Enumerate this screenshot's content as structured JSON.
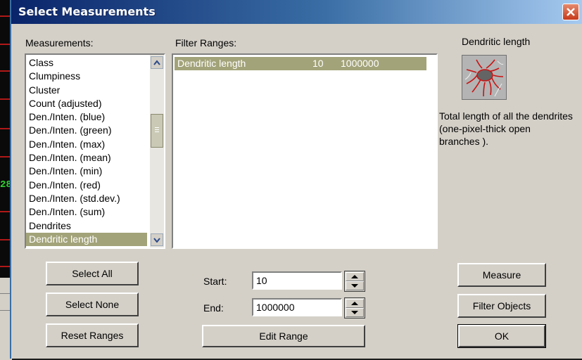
{
  "dialog": {
    "title": "Select Measurements",
    "measurements_label": "Measurements:",
    "filter_ranges_label": "Filter Ranges:"
  },
  "measurements": {
    "items": [
      "Class",
      "Clumpiness",
      "Cluster",
      "Count (adjusted)",
      "Den./Inten. (blue)",
      "Den./Inten. (green)",
      "Den./Inten. (max)",
      "Den./Inten. (mean)",
      "Den./Inten. (min)",
      "Den./Inten. (red)",
      "Den./Inten. (std.dev.)",
      "Den./Inten. (sum)",
      "Dendrites",
      "Dendritic length"
    ],
    "selected": "Dendritic length"
  },
  "filter_ranges": {
    "rows": [
      {
        "name": "Dendritic length",
        "start": "10",
        "end": "1000000"
      }
    ]
  },
  "preview": {
    "title": "Dendritic length",
    "description": "Total length of all the dendrites (one-pixel-thick open branches ).",
    "icon": "dendrite-icon"
  },
  "buttons": {
    "select_all": "Select All",
    "select_none": "Select None",
    "reset_ranges": "Reset Ranges",
    "edit_range": "Edit Range",
    "measure": "Measure",
    "filter_objects": "Filter Objects",
    "ok": "OK"
  },
  "range": {
    "start_label": "Start:",
    "start_value": "10",
    "end_label": "End:",
    "end_value": "1000000"
  },
  "background": {
    "number_fragment": "28"
  },
  "colors": {
    "selection": "#a3a37a",
    "title_start": "#0a246a",
    "title_end": "#a6caf0",
    "close": "#c7391a"
  }
}
